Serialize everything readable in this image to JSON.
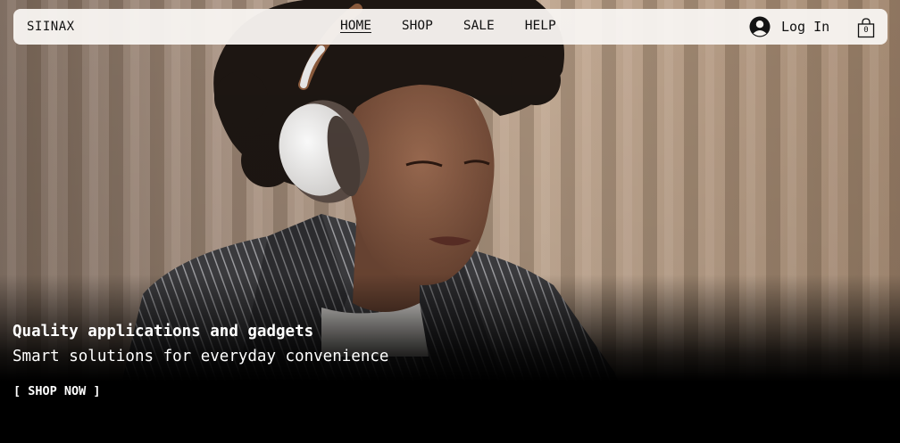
{
  "brand": {
    "name": "SIINAX"
  },
  "nav": {
    "links": [
      {
        "label": "HOME",
        "active": true
      },
      {
        "label": "SHOP"
      },
      {
        "label": "SALE"
      },
      {
        "label": "HELP"
      }
    ]
  },
  "account": {
    "login_label": "Log In",
    "avatar_icon": "user-avatar-icon"
  },
  "cart": {
    "count": "0",
    "icon": "shopping-bag-icon"
  },
  "hero": {
    "title": "Quality applications and gadgets",
    "subtitle": "Smart solutions for everyday convenience",
    "cta_label": "[ SHOP NOW ]"
  },
  "colors": {
    "navbar_bg": "#f7f4f0",
    "text_dark": "#111111",
    "hero_text": "#ffffff",
    "background": "#000000",
    "wall_wood": "#b79c86"
  }
}
